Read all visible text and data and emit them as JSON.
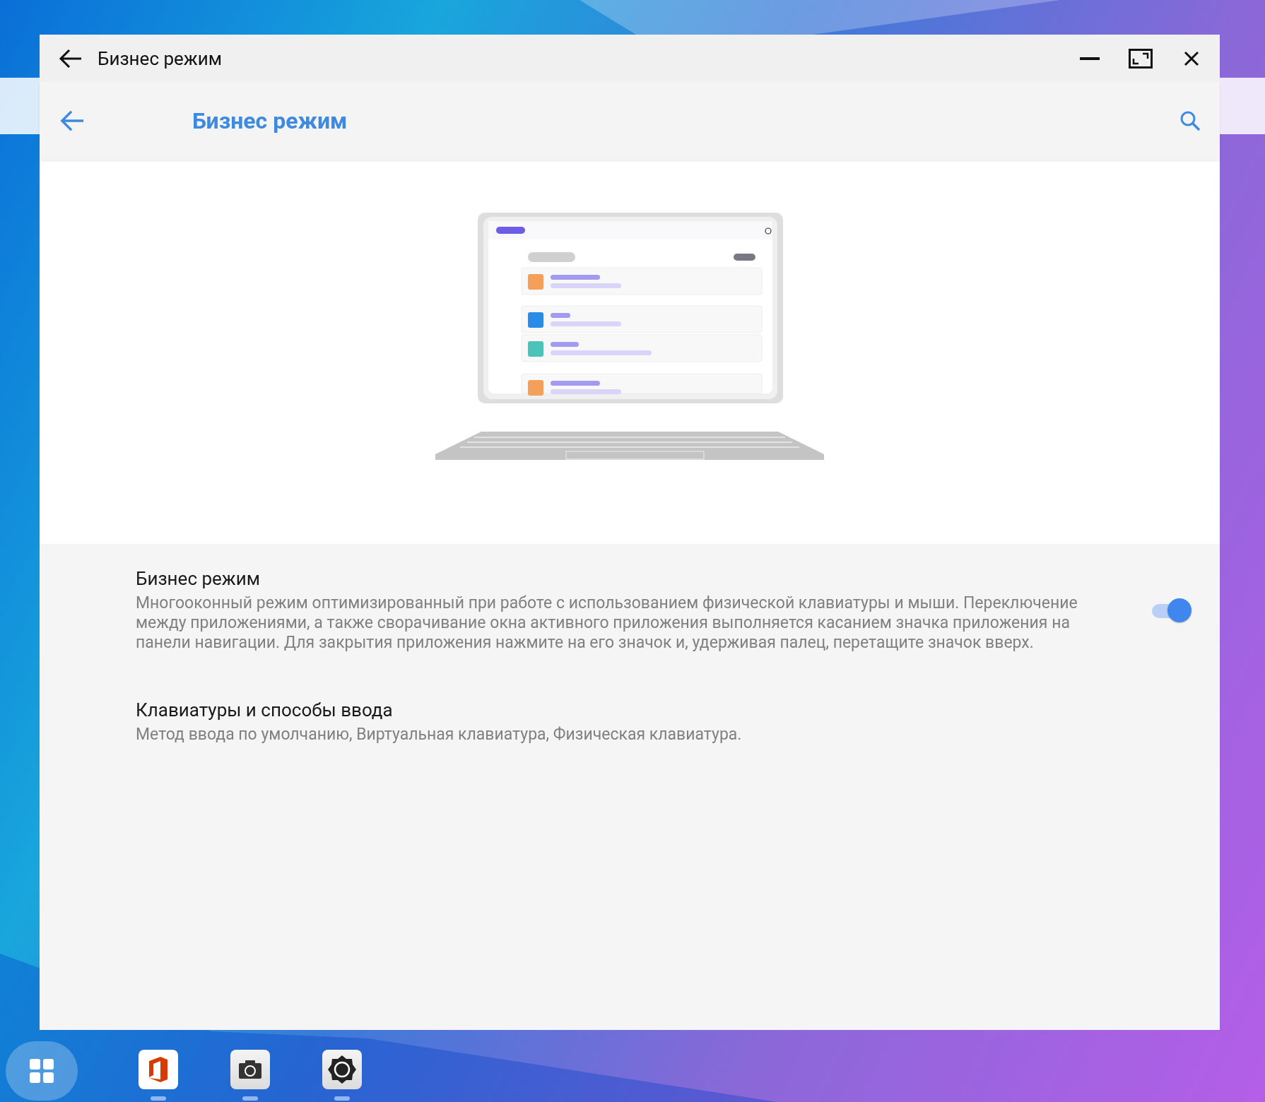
{
  "window": {
    "title": "Бизнес режим"
  },
  "app_bar": {
    "title": "Бизнес режим"
  },
  "settings": [
    {
      "kind": "toggle",
      "title": "Бизнес режим",
      "summary": "Многооконный режим оптимизированный при работе с использованием физической клавиатуры и мыши. Переключение между приложениями, а также сворачивание окна активного приложения выполняется касанием значка приложения на панели навигации. Для закрытия приложения нажмите на его значок и, удерживая палец, перетащите значок вверх.",
      "on": true
    },
    {
      "kind": "link",
      "title": "Клавиатуры и способы ввода",
      "summary": "Метод ввода по умолчанию, Виртуальная клавиатура, Физическая клавиатура."
    }
  ],
  "taskbar": {
    "apps": [
      {
        "kind": "office",
        "running": true
      },
      {
        "kind": "camera",
        "running": true
      },
      {
        "kind": "settings",
        "running": true
      }
    ]
  }
}
